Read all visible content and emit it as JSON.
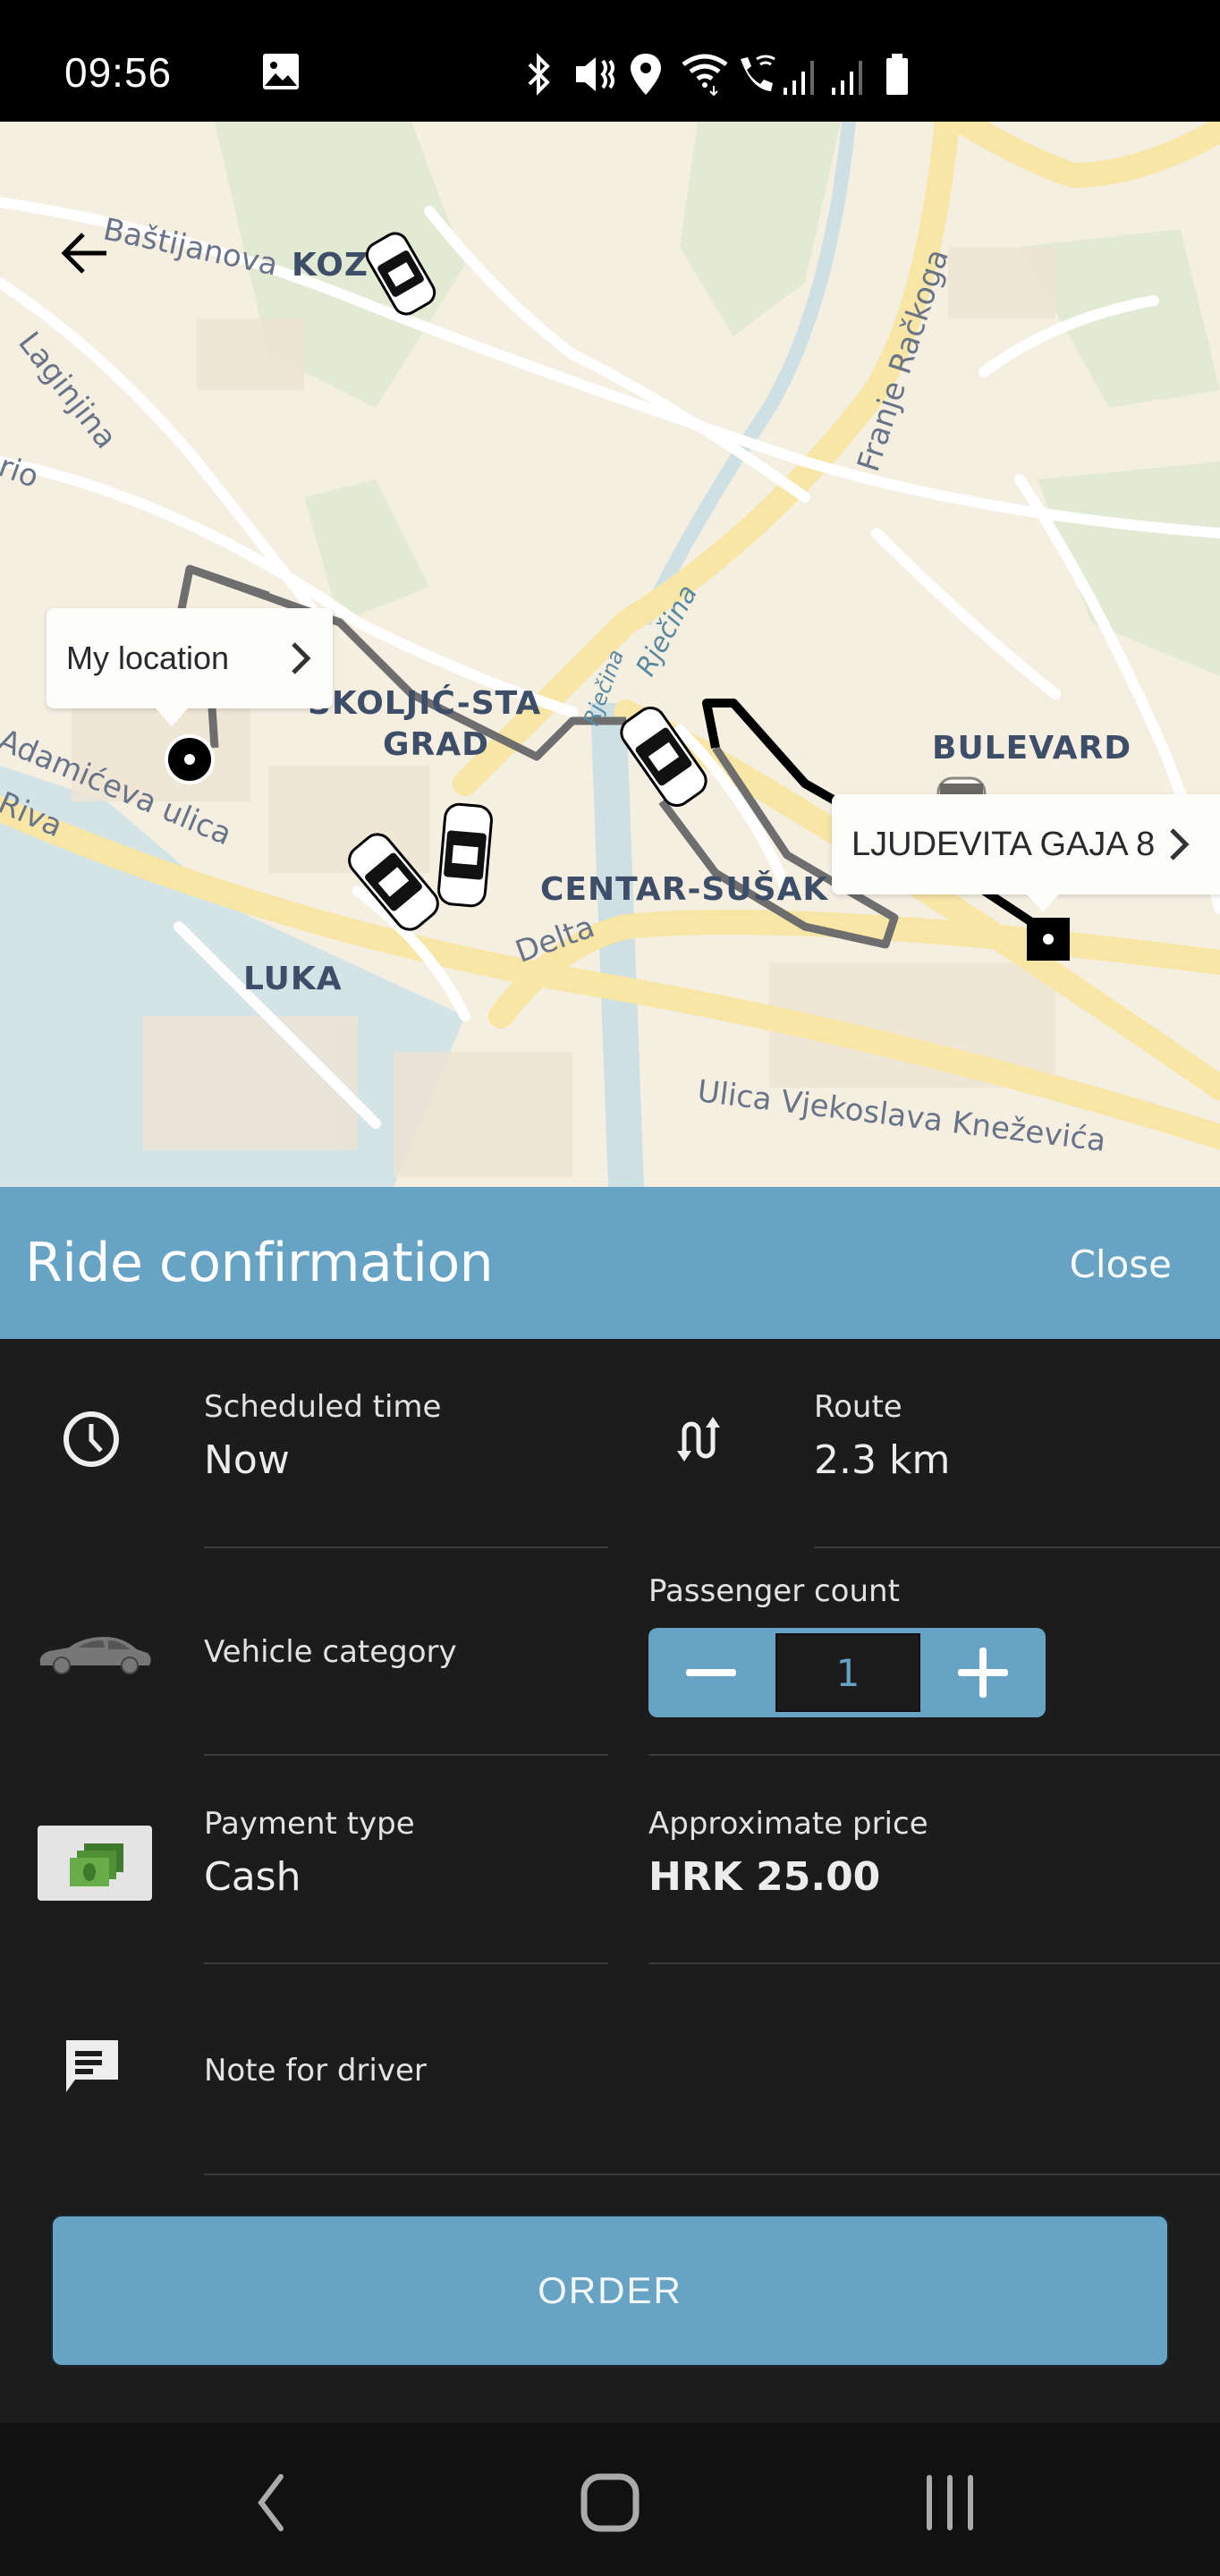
{
  "status_bar": {
    "time": "09:56",
    "icons": [
      "gallery-icon",
      "bluetooth-icon",
      "mute-icon",
      "location-icon",
      "wifi-icon",
      "wifi-calling-icon",
      "signal-icon",
      "signal-icon",
      "battery-icon"
    ]
  },
  "map": {
    "back_icon": "arrow-left-icon",
    "labels": {
      "bastijanova": "Baštijanova",
      "koz": "KOZ",
      "laginjina": "Laginjina",
      "rio": "rio",
      "adamiceva": "Adamićeva ulica",
      "riva": "Riva",
      "skoljic": "ŠKOLJIĆ-STA",
      "grad": "GRAD",
      "rjecina": "Rječina",
      "rjecina2": "Rječina",
      "franje": "Franje Račkoga",
      "bulevard": "BULEVARD",
      "centar": "CENTAR-SUŠAK",
      "delta": "Delta",
      "luka": "LUKA",
      "vjekoslava": "Ulica Vjekoslava Kneževića"
    },
    "pickup_bubble": {
      "label": "My location",
      "icon": "chevron-right-icon"
    },
    "destination_bubble": {
      "label": "LJUDEVITA GAJA 8",
      "icon": "chevron-right-icon"
    }
  },
  "sheet": {
    "title": "Ride confirmation",
    "close_label": "Close",
    "accent_color": "#66a3c5",
    "rows": {
      "scheduled_time": {
        "label": "Scheduled time",
        "value": "Now",
        "icon": "clock-icon"
      },
      "route": {
        "label": "Route",
        "value": "2.3 km",
        "icon": "route-icon"
      },
      "vehicle_category": {
        "label": "Vehicle category",
        "icon": "car-icon"
      },
      "passenger_count": {
        "label": "Passenger count",
        "value": "1"
      },
      "payment_type": {
        "label": "Payment type",
        "value": "Cash",
        "icon": "cash-icon"
      },
      "approximate_price": {
        "label": "Approximate price",
        "value": "HRK 25.00"
      },
      "note": {
        "label": "Note for driver",
        "icon": "note-icon"
      }
    },
    "order_label": "ORDER"
  },
  "nav_bar": {
    "buttons": [
      "back",
      "home",
      "recents"
    ]
  }
}
